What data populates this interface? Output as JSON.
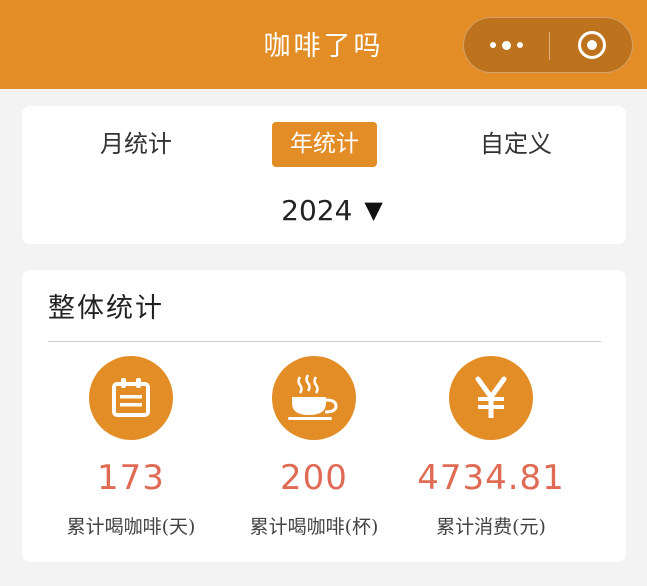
{
  "header": {
    "title": "咖啡了吗",
    "more_icon": "more-dots-icon",
    "close_icon": "target-close-icon"
  },
  "colors": {
    "accent": "#e38d27",
    "value": "#e06b55",
    "background": "#f3f3f3"
  },
  "tabs": [
    {
      "label": "月统计",
      "active": false
    },
    {
      "label": "年统计",
      "active": true
    },
    {
      "label": "自定义",
      "active": false
    }
  ],
  "year_picker": {
    "value": "2024",
    "caret": "▼"
  },
  "stats": {
    "title": "整体统计",
    "items": [
      {
        "icon": "calendar-icon",
        "value": "173",
        "label": "累计喝咖啡(天)"
      },
      {
        "icon": "coffee-cup-icon",
        "value": "200",
        "label": "累计喝咖啡(杯)"
      },
      {
        "icon": "yen-icon",
        "value": "4734.81",
        "label": "累计消费(元)"
      }
    ]
  }
}
